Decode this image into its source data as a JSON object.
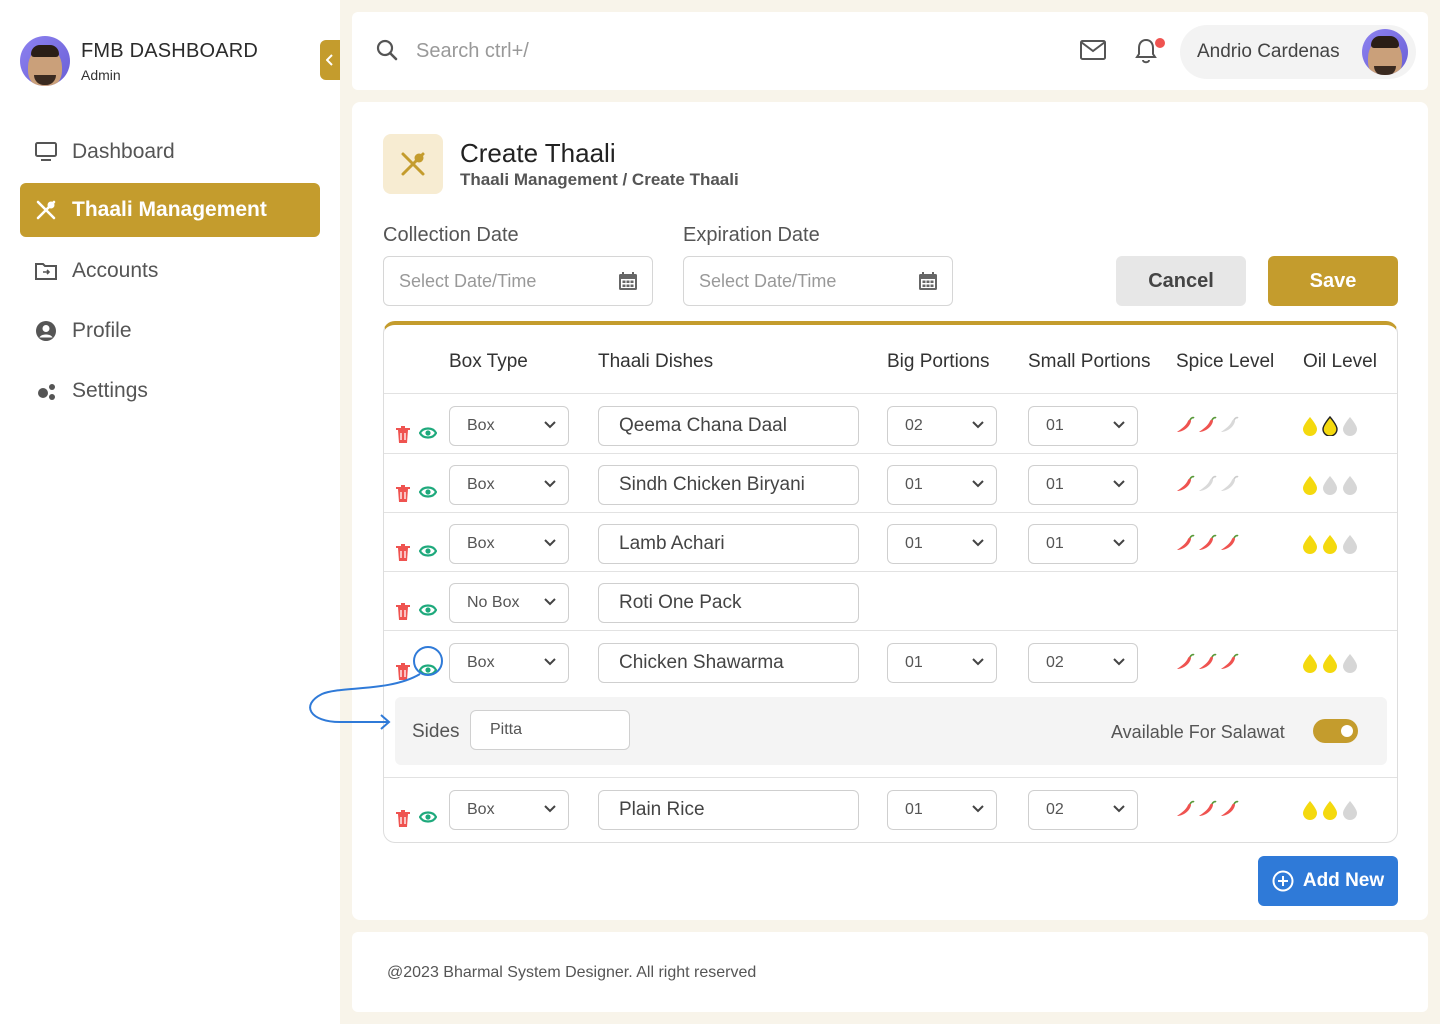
{
  "sidebar": {
    "brand_title": "FMB DASHBOARD",
    "brand_role": "Admin",
    "items": [
      {
        "label": "Dashboard",
        "icon": "monitor-icon",
        "active": false
      },
      {
        "label": "Thaali Management",
        "icon": "utensils-icon",
        "active": true
      },
      {
        "label": "Accounts",
        "icon": "folder-icon",
        "active": false
      },
      {
        "label": "Profile",
        "icon": "user-circle-icon",
        "active": false
      },
      {
        "label": "Settings",
        "icon": "settings-dots-icon",
        "active": false
      }
    ]
  },
  "topbar": {
    "search_placeholder": "Search ctrl+/",
    "user_name": "Andrio Cardenas"
  },
  "page": {
    "title": "Create Thaali",
    "breadcrumb": "Thaali Management / Create Thaali",
    "collection_label": "Collection Date",
    "expiration_label": "Expiration Date",
    "date_placeholder": "Select Date/Time",
    "cancel_label": "Cancel",
    "save_label": "Save",
    "add_new_label": "Add New"
  },
  "table": {
    "headers": {
      "box_type": "Box Type",
      "dishes": "Thaali Dishes",
      "big": "Big Portions",
      "small": "Small Portions",
      "spice": "Spice Level",
      "oil": "Oil Level"
    },
    "rows": [
      {
        "box": "Box",
        "dish": "Qeema Chana Daal",
        "big": "02",
        "small": "01",
        "spice": 2,
        "oil": 2
      },
      {
        "box": "Box",
        "dish": "Sindh Chicken Biryani",
        "big": "01",
        "small": "01",
        "spice": 1,
        "oil": 1
      },
      {
        "box": "Box",
        "dish": "Lamb Achari",
        "big": "01",
        "small": "01",
        "spice": 3,
        "oil": 2
      },
      {
        "box": "No Box",
        "dish": "Roti One Pack"
      },
      {
        "box": "Box",
        "dish": "Chicken Shawarma",
        "big": "01",
        "small": "02",
        "spice": 3,
        "oil": 2
      },
      {
        "box": "Box",
        "dish": "Plain Rice",
        "big": "01",
        "small": "02",
        "spice": 3,
        "oil": 2
      }
    ],
    "sides": {
      "label": "Sides",
      "value": "Pitta",
      "salawat_label": "Available For Salawat",
      "salawat_on": true
    }
  },
  "footer": {
    "text": "@2023 Bharmal System Designer. All right reserved"
  },
  "colors": {
    "accent": "#c49c2d",
    "blue": "#2f7ad8",
    "danger": "#ef5350",
    "eye": "#1ea97c",
    "oil": "#f4d90e"
  }
}
